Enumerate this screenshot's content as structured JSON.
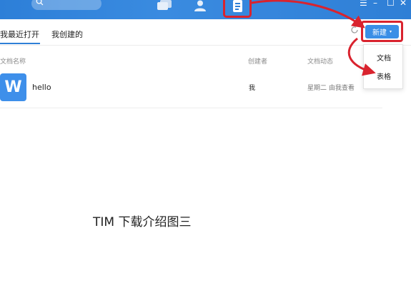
{
  "titlebar": {
    "icons": [
      "search-icon",
      "chat-icon",
      "contacts-icon",
      "docs-icon"
    ],
    "window_controls": {
      "menu": "☰",
      "minimize": "–",
      "maximize": "☐",
      "close": "✕"
    }
  },
  "tabs": [
    {
      "label": "我最近打开"
    },
    {
      "label": "我创建的"
    }
  ],
  "new_button": {
    "label": "新建",
    "caret": "▾"
  },
  "new_menu": [
    {
      "label": "文档"
    },
    {
      "label": "表格"
    }
  ],
  "table": {
    "headers": {
      "name": "文档名称",
      "creator": "创建者",
      "activity": "文档动态"
    },
    "rows": [
      {
        "icon_letter": "W",
        "name": "hello",
        "creator": "我",
        "activity": "星期二 由我查看"
      }
    ]
  },
  "caption": "TIM 下载介绍图三",
  "colors": {
    "accent": "#2f7fd6",
    "highlight": "#d9232e"
  }
}
